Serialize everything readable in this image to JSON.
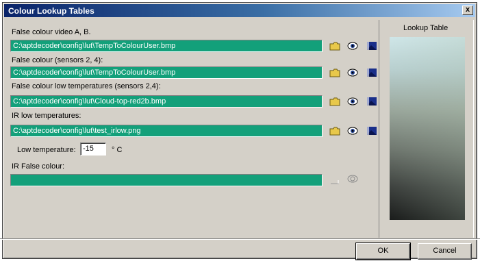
{
  "window": {
    "title": "Colour Lookup Tables",
    "close_label": "x"
  },
  "sections": [
    {
      "label": "False colour video A, B.",
      "path": "C:\\aptdecoder\\config\\lut\\TempToColourUser.bmp"
    },
    {
      "label": "False colour (sensors 2, 4):",
      "path": "C:\\aptdecoder\\config\\lut\\TempToColourUser.bmp"
    },
    {
      "label": "False colour low temperatures (sensors 2,4):",
      "path": "C:\\aptdecoder\\config\\lut\\Cloud-top-red2b.bmp"
    },
    {
      "label": "IR low temperatures:",
      "path": "C:\\aptdecoder\\config\\lut\\test_irlow.png"
    }
  ],
  "low_temperature": {
    "label": "Low temperature:",
    "value": "-15",
    "unit": "° C"
  },
  "ir_false_colour": {
    "label": "IR False colour:",
    "path": ""
  },
  "lookup_table": {
    "label": "Lookup Table"
  },
  "buttons": {
    "ok": "OK",
    "cancel": "Cancel"
  },
  "icons": {
    "folder": "folder-icon",
    "view": "eye-icon",
    "preview": "image-icon"
  },
  "colors": {
    "field": "#13a07a",
    "dialog": "#d4d0c8",
    "title_start": "#0a246a",
    "title_end": "#a6caf0"
  }
}
